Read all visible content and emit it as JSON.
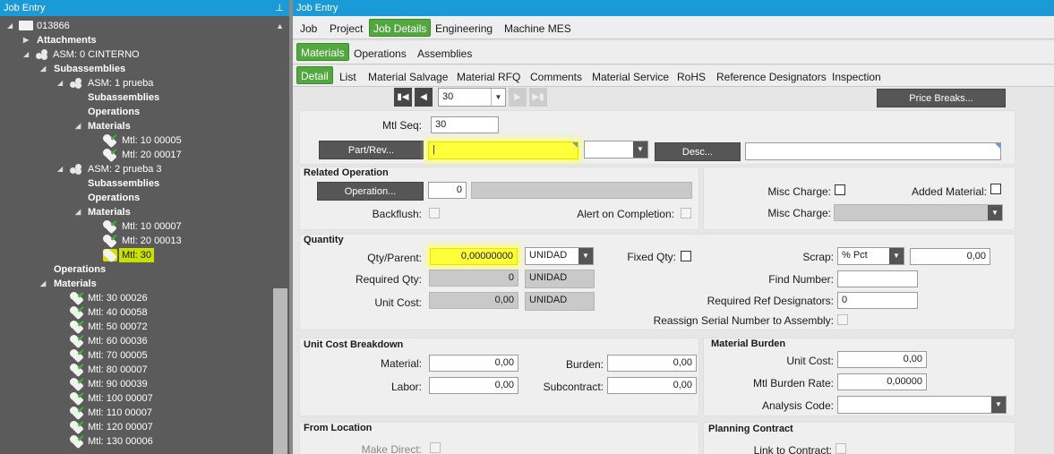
{
  "left_panel": {
    "title": "Job Entry",
    "pin": "📌",
    "tree": {
      "job": "013866",
      "attachments": "Attachments",
      "asm0": "ASM: 0 CINTERNO",
      "subassemblies": "Subassemblies",
      "asm1": "ASM: 1 prueba",
      "asm1_sub": "Subassemblies",
      "asm1_ops": "Operations",
      "asm1_mat": "Materials",
      "asm1_m1": "Mtl: 10 00005",
      "asm1_m2": "Mtl: 20 00017",
      "asm2": "ASM: 2 prueba 3",
      "asm2_sub": "Subassemblies",
      "asm2_ops": "Operations",
      "asm2_mat": "Materials",
      "asm2_m1": "Mtl: 10 00007",
      "asm2_m2": "Mtl: 20 00013",
      "asm2_m3": "Mtl: 30",
      "operations": "Operations",
      "materials": "Materials",
      "mats": [
        "Mtl: 30 00026",
        "Mtl: 40 00058",
        "Mtl: 50 00072",
        "Mtl: 60 00036",
        "Mtl: 70 00005",
        "Mtl: 80 00007",
        "Mtl: 90 00039",
        "Mtl: 100 00007",
        "Mtl: 110 00007",
        "Mtl: 120 00007",
        "Mtl: 130 00006"
      ]
    }
  },
  "right_panel": {
    "title": "Job Entry",
    "tabs1": [
      "Job",
      "Project",
      "Job Details",
      "Engineering",
      "Machine MES"
    ],
    "tabs2": [
      "Materials",
      "Operations",
      "Assemblies"
    ],
    "tabs3": [
      "Detail",
      "List",
      "Material Salvage",
      "Material RFQ",
      "Comments",
      "Material Service",
      "RoHS",
      "Reference Designators",
      "Inspection"
    ],
    "nav_value": "30",
    "price_breaks": "Price Breaks...",
    "mtl_seq_label": "Mtl Seq:",
    "mtl_seq": "30",
    "part_rev_btn": "Part/Rev...",
    "desc_btn": "Desc...",
    "related_op": {
      "title": "Related Operation",
      "op_btn": "Operation...",
      "op_value": "0",
      "backflush": "Backflush:",
      "alert": "Alert on Completion:"
    },
    "misc": {
      "misc_charge1": "Misc Charge:",
      "added_material": "Added Material:",
      "misc_charge2": "Misc Charge:"
    },
    "quantity": {
      "title": "Quantity",
      "qty_parent_label": "Qty/Parent:",
      "qty_parent": "0,00000000",
      "uom": "UNIDAD",
      "fixed_qty": "Fixed Qty:",
      "scrap_label": "Scrap:",
      "scrap_type": "% Pct",
      "scrap_value": "0,00",
      "required_qty_label": "Required Qty:",
      "required_qty": "0",
      "required_uom": "UNIDAD",
      "find_number": "Find Number:",
      "unit_cost_label": "Unit Cost:",
      "unit_cost": "0,00",
      "unit_cost_uom": "UNIDAD",
      "req_ref_label": "Required Ref Designators:",
      "req_ref": "0",
      "reassign": "Reassign Serial Number to Assembly:"
    },
    "unit_cost_breakdown": {
      "title": "Unit Cost Breakdown",
      "material_label": "Material:",
      "material": "0,00",
      "burden_label": "Burden:",
      "burden": "0,00",
      "labor_label": "Labor:",
      "labor": "0,00",
      "subcontract_label": "Subcontract:",
      "subcontract": "0,00"
    },
    "material_burden": {
      "title": "Material Burden",
      "unit_cost_label": "Unit Cost:",
      "unit_cost": "0,00",
      "rate_label": "Mtl  Burden Rate:",
      "rate": "0,00000",
      "analysis_label": "Analysis Code:"
    },
    "from_location": {
      "title": "From Location",
      "make_direct": "Make Direct:"
    },
    "planning_contract": {
      "title": "Planning Contract",
      "link": "Link to Contract:"
    }
  }
}
